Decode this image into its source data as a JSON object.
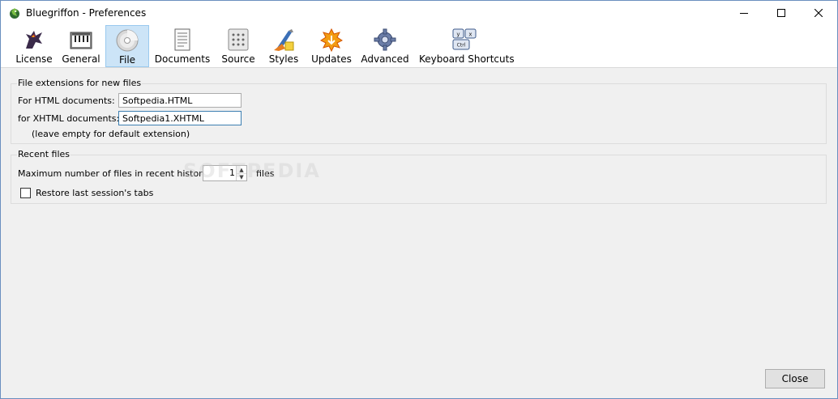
{
  "window": {
    "title": "Bluegriffon - Preferences"
  },
  "toolbar": {
    "items": [
      {
        "label": "License",
        "icon": "griffon-icon"
      },
      {
        "label": "General",
        "icon": "piano-icon"
      },
      {
        "label": "File",
        "icon": "disc-icon",
        "selected": true
      },
      {
        "label": "Documents",
        "icon": "document-icon"
      },
      {
        "label": "Source",
        "icon": "source-icon"
      },
      {
        "label": "Styles",
        "icon": "brush-icon"
      },
      {
        "label": "Updates",
        "icon": "update-icon"
      },
      {
        "label": "Advanced",
        "icon": "gear-icon"
      },
      {
        "label": "Keyboard Shortcuts",
        "icon": "keyboard-icon"
      }
    ]
  },
  "file_extensions": {
    "legend": "File extensions for new files",
    "html_label": "For HTML documents:",
    "html_value": "Softpedia.HTML",
    "xhtml_label": "for XHTML documents:",
    "xhtml_value": "Softpedia1.XHTML",
    "hint": "(leave empty for default extension)"
  },
  "recent_files": {
    "legend": "Recent files",
    "max_label": "Maximum number of files in recent history:",
    "max_value": "1",
    "unit": "files",
    "restore_label": "Restore last session's tabs",
    "restore_checked": false
  },
  "watermark": "SOFTPEDIA",
  "footer": {
    "close_label": "Close"
  }
}
